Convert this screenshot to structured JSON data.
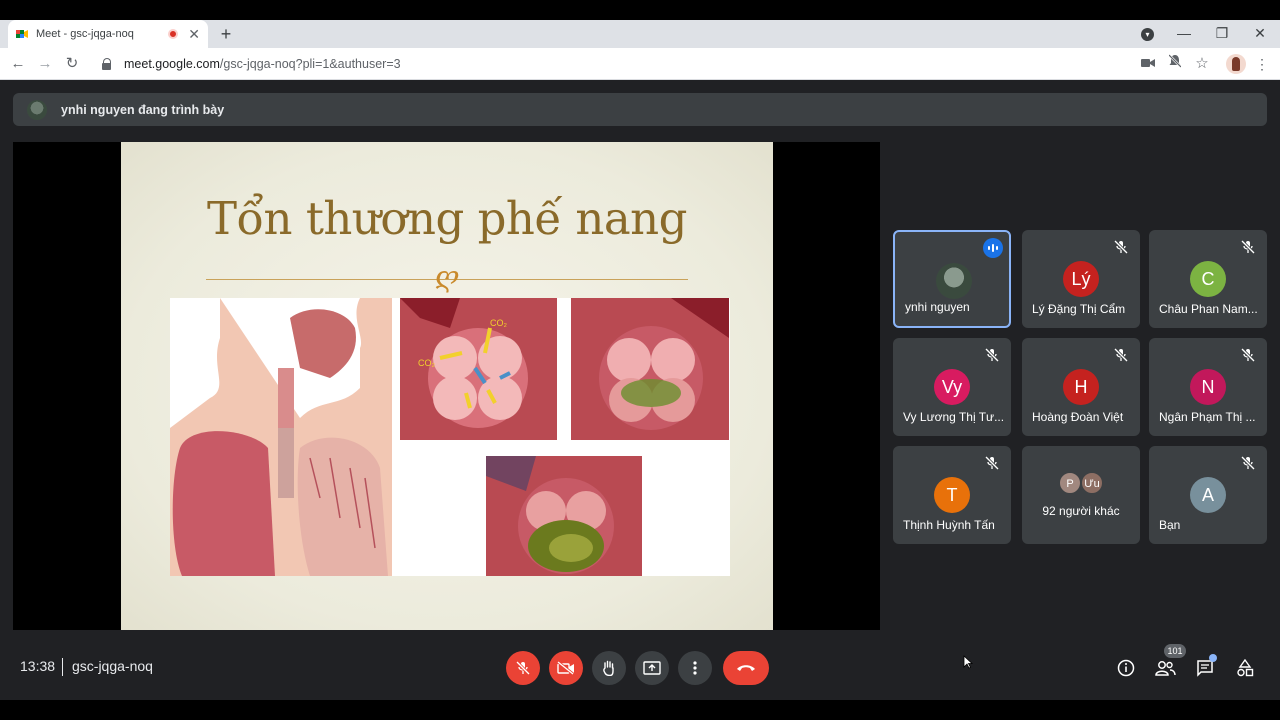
{
  "browser": {
    "tab_title": "Meet - gsc-jqga-noq",
    "url_host": "meet.google.com",
    "url_path": "/gsc-jqga-noq?pli=1&authuser=3"
  },
  "meet": {
    "presenter_text": "ynhi nguyen đang trình bày",
    "slide": {
      "title": "Tổn thương phế nang",
      "ornament": "ღ"
    },
    "participants": [
      {
        "name": "ynhi nguyen",
        "initial": "",
        "color": "#4a5a4e",
        "muted": false,
        "speaking": true
      },
      {
        "name": "Lý Đặng Thị Cẩm",
        "initial": "Lý",
        "color": "#c5221f",
        "muted": true
      },
      {
        "name": "Châu Phan Nam...",
        "initial": "C",
        "color": "#7cb342",
        "muted": true
      },
      {
        "name": "Vy Lương Thị Tư...",
        "initial": "Vy",
        "color": "#d81b60",
        "muted": true
      },
      {
        "name": "Hoàng Đoàn Việt",
        "initial": "H",
        "color": "#c5221f",
        "muted": true
      },
      {
        "name": "Ngân Phạm Thị ...",
        "initial": "N",
        "color": "#c2185b",
        "muted": true
      },
      {
        "name": "Thịnh Huỳnh Tấn",
        "initial": "T",
        "color": "#e8710a",
        "muted": true
      },
      {
        "name": "92 người khác",
        "initial": "",
        "color": "",
        "muted": false
      },
      {
        "name": "Bạn",
        "initial": "A",
        "color": "#78909c",
        "muted": true
      }
    ],
    "others": {
      "a": "P",
      "a_color": "#a1887f",
      "b": "Ưu",
      "b_color": "#8d6e63"
    },
    "bottom": {
      "time": "13:38",
      "code": "gsc-jqga-noq",
      "people_count": "101"
    }
  }
}
